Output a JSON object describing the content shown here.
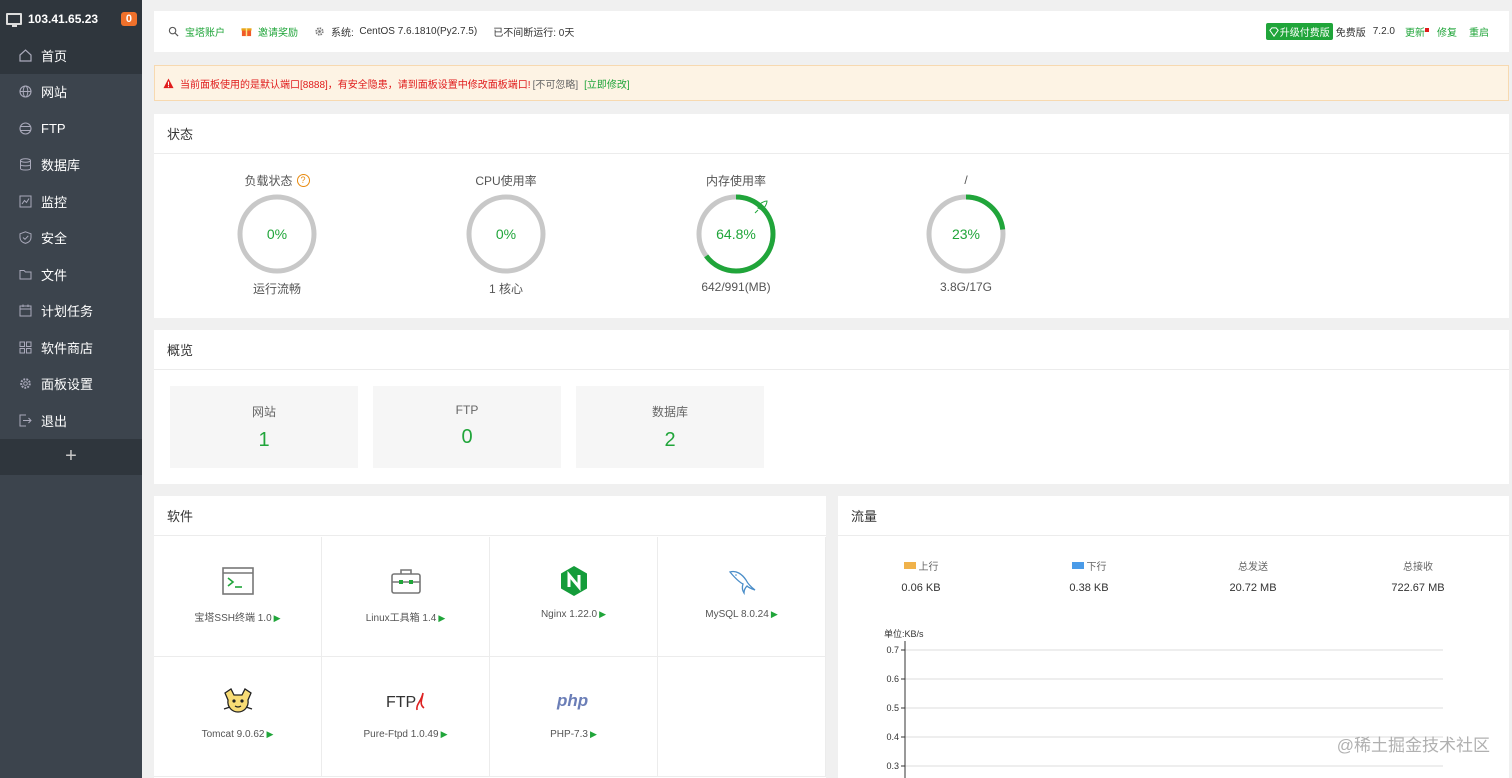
{
  "sidebar": {
    "ip": "103.41.65.23",
    "badge": "0",
    "items": [
      {
        "label": "首页",
        "icon": "home-icon"
      },
      {
        "label": "网站",
        "icon": "globe-icon"
      },
      {
        "label": "FTP",
        "icon": "ftp-icon"
      },
      {
        "label": "数据库",
        "icon": "database-icon"
      },
      {
        "label": "监控",
        "icon": "monitor-icon"
      },
      {
        "label": "安全",
        "icon": "shield-icon"
      },
      {
        "label": "文件",
        "icon": "folder-icon"
      },
      {
        "label": "计划任务",
        "icon": "calendar-icon"
      },
      {
        "label": "软件商店",
        "icon": "grid-icon"
      },
      {
        "label": "面板设置",
        "icon": "gear-icon"
      },
      {
        "label": "退出",
        "icon": "logout-icon"
      }
    ],
    "add": "+"
  },
  "topbar": {
    "account": "宝塔账户",
    "invite": "邀请奖励",
    "system_label": "系统:",
    "system_value": "CentOS 7.6.1810(Py2.7.5)",
    "uptime": "已不间断运行: 0天",
    "upgrade": "升级付费版",
    "edition": "免费版",
    "version": "7.2.0",
    "update": "更新",
    "repair": "修复",
    "restart": "重启"
  },
  "warning": {
    "message": "当前面板使用的是默认端口[8888]，有安全隐患，请到面板设置中修改面板端口!",
    "ignore": "[不可忽略]",
    "fix": "[立即修改]"
  },
  "status": {
    "title": "状态",
    "gauges": [
      {
        "label": "负载状态",
        "value": "0%",
        "percent": 0,
        "sub": "运行流畅",
        "help": "?"
      },
      {
        "label": "CPU使用率",
        "value": "0%",
        "percent": 0,
        "sub": "1 核心"
      },
      {
        "label": "内存使用率",
        "value": "64.8%",
        "percent": 64.8,
        "sub": "642/991(MB)"
      },
      {
        "label": "/",
        "value": "23%",
        "percent": 23,
        "sub": "3.8G/17G"
      }
    ]
  },
  "overview": {
    "title": "概览",
    "cards": [
      {
        "label": "网站",
        "value": "1"
      },
      {
        "label": "FTP",
        "value": "0"
      },
      {
        "label": "数据库",
        "value": "2"
      }
    ]
  },
  "software": {
    "title": "软件",
    "items": [
      {
        "name": "宝塔SSH终端 1.0",
        "icon": "terminal-icon"
      },
      {
        "name": "Linux工具箱 1.4",
        "icon": "toolbox-icon"
      },
      {
        "name": "Nginx 1.22.0",
        "icon": "nginx-icon"
      },
      {
        "name": "MySQL 8.0.24",
        "icon": "mysql-icon"
      },
      {
        "name": "Tomcat 9.0.62",
        "icon": "tomcat-icon"
      },
      {
        "name": "Pure-Ftpd 1.0.49",
        "icon": "ftp-logo-icon"
      },
      {
        "name": "PHP-7.3",
        "icon": "php-icon"
      }
    ],
    "play": "▶"
  },
  "traffic": {
    "title": "流量",
    "up_label": "上行",
    "up_value": "0.06 KB",
    "down_label": "下行",
    "down_value": "0.38 KB",
    "sent_label": "总发送",
    "sent_value": "20.72 MB",
    "recv_label": "总接收",
    "recv_value": "722.67 MB",
    "colors": {
      "up": "#f0b24a",
      "down": "#4a9be8"
    }
  },
  "chart_data": {
    "type": "line",
    "ylabel": "单位:KB/s",
    "ytick_labels": [
      "0.7",
      "0.6",
      "0.5",
      "0.4",
      "0.3"
    ],
    "ylim": [
      0.3,
      0.7
    ],
    "grid": true,
    "series": []
  },
  "watermark": "@稀土掘金技术社区",
  "colors": {
    "accent": "#20a53a",
    "sidebar": "#3c444d",
    "warning": "#e01b1b"
  }
}
